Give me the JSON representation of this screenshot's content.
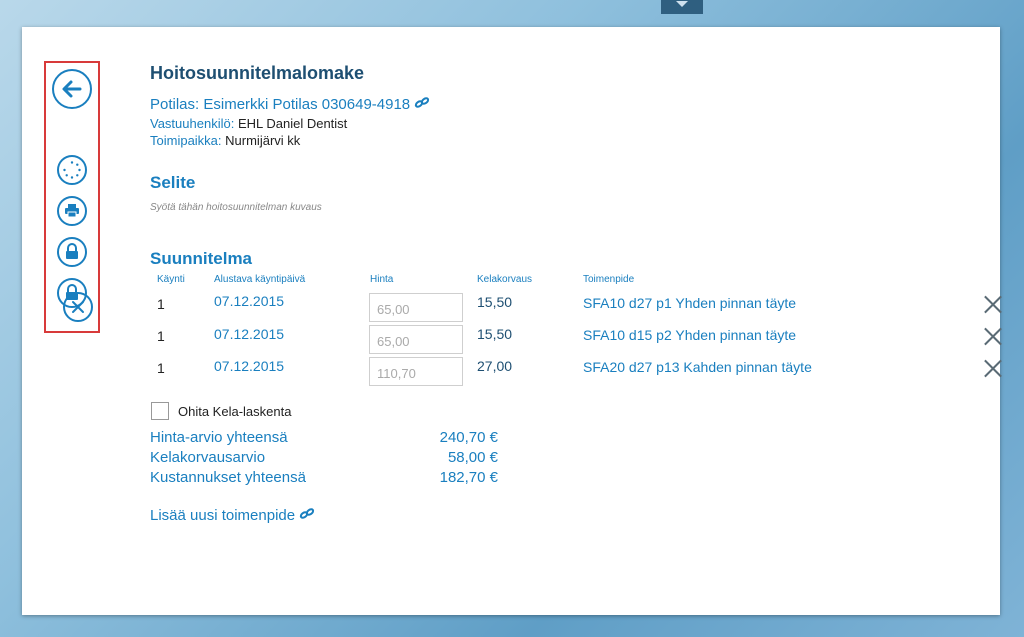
{
  "header": {
    "title": "Hoitosuunnitelmalomake"
  },
  "patient": {
    "label": "Potilas:",
    "value": "Esimerkki Potilas 030649-4918",
    "link_icon": "link-icon"
  },
  "responsible": {
    "label": "Vastuuhenkilö:",
    "value": "EHL Daniel Dentist"
  },
  "location": {
    "label": "Toimipaikka:",
    "value": "Nurmijärvi kk"
  },
  "description": {
    "heading": "Selite",
    "placeholder": "Syötä tähän hoitosuunnitelman kuvaus"
  },
  "plan": {
    "heading": "Suunnitelma",
    "columns": {
      "visit": "Käynti",
      "date": "Alustava käyntipäivä",
      "price": "Hinta",
      "kela": "Kelakorvaus",
      "procedure": "Toimenpide"
    },
    "rows": [
      {
        "visit": "1",
        "date": "07.12.2015",
        "price": "65,00",
        "kela": "15,50",
        "procedure": "SFA10 d27 p1 Yhden pinnan täyte"
      },
      {
        "visit": "1",
        "date": "07.12.2015",
        "price": "65,00",
        "kela": "15,50",
        "procedure": "SFA10 d15 p2 Yhden pinnan täyte"
      },
      {
        "visit": "1",
        "date": "07.12.2015",
        "price": "110,70",
        "kela": "27,00",
        "procedure": "SFA20 d27 p13 Kahden pinnan täyte"
      }
    ]
  },
  "skip_kela": {
    "label": "Ohita Kela-laskenta",
    "checked": false
  },
  "summary": {
    "total_label": "Hinta-arvio yhteensä",
    "total_value": "240,70 €",
    "kela_label": "Kelakorvausarvio",
    "kela_value": "58,00 €",
    "cost_label": "Kustannukset yhteensä",
    "cost_value": "182,70 €"
  },
  "add_procedure": {
    "label": "Lisää uusi toimenpide"
  },
  "toolbar": {
    "icons": [
      "back-arrow-icon",
      "spinner-icon",
      "printer-icon",
      "lock-icon",
      "lock-icon",
      "close-icon"
    ]
  },
  "colors": {
    "accent": "#1a7fbf",
    "title": "#1e4f72",
    "highlight": "#d83a3a"
  }
}
